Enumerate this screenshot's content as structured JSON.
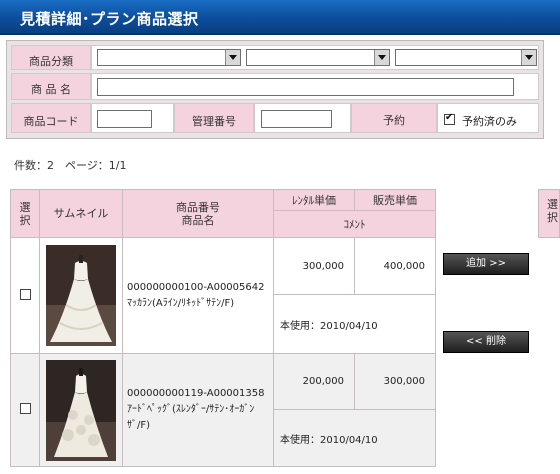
{
  "window": {
    "title": "見積詳細･プラン商品選択"
  },
  "search": {
    "category_label": "商品分類",
    "category_selects": [
      "",
      "",
      ""
    ],
    "name_label": "商 品 名",
    "name_value": "",
    "code_label": "商品コード",
    "code_value": "",
    "mgmt_label": "管理番号",
    "mgmt_value": "",
    "reserve_label": "予約",
    "reserved_only_label": "予約済のみ",
    "reserved_only_checked": true
  },
  "info": {
    "count_text": "件数：2　ページ：1/1"
  },
  "table": {
    "headers": {
      "select": "選択",
      "thumbnail": "サムネイル",
      "product_no": "商品番号",
      "product_name": "商品名",
      "rental_price": "ﾚﾝﾀﾙ単価",
      "sale_price": "販売単価",
      "comment": "ｺﾒﾝﾄ"
    },
    "rows": [
      {
        "code": "000000000100-A00005642",
        "name": "ﾏｯｶﾗﾝ(Aﾗｲﾝ/ﾘｷｯﾄﾞｻﾃﾝ/F)",
        "rental": "300,000",
        "sale": "400,000",
        "comment": "本使用：2010/04/10",
        "thumbnail_icon": "dress-photo",
        "checked": false
      },
      {
        "code": "000000000119-A00001358",
        "name": "ｱｰﾄﾞﾍﾟｯｸﾞ(ｽﾚﾝﾀﾞｰ/ｻﾃﾝ･ｵｰｶﾞﾝｻﾞ/F)",
        "rental": "200,000",
        "sale": "300,000",
        "comment": "本使用：2010/04/10",
        "thumbnail_icon": "dress-photo",
        "checked": false
      }
    ]
  },
  "buttons": {
    "add": "追加 >>",
    "remove": "<< 削除"
  },
  "right_table": {
    "select_header": "選択"
  }
}
